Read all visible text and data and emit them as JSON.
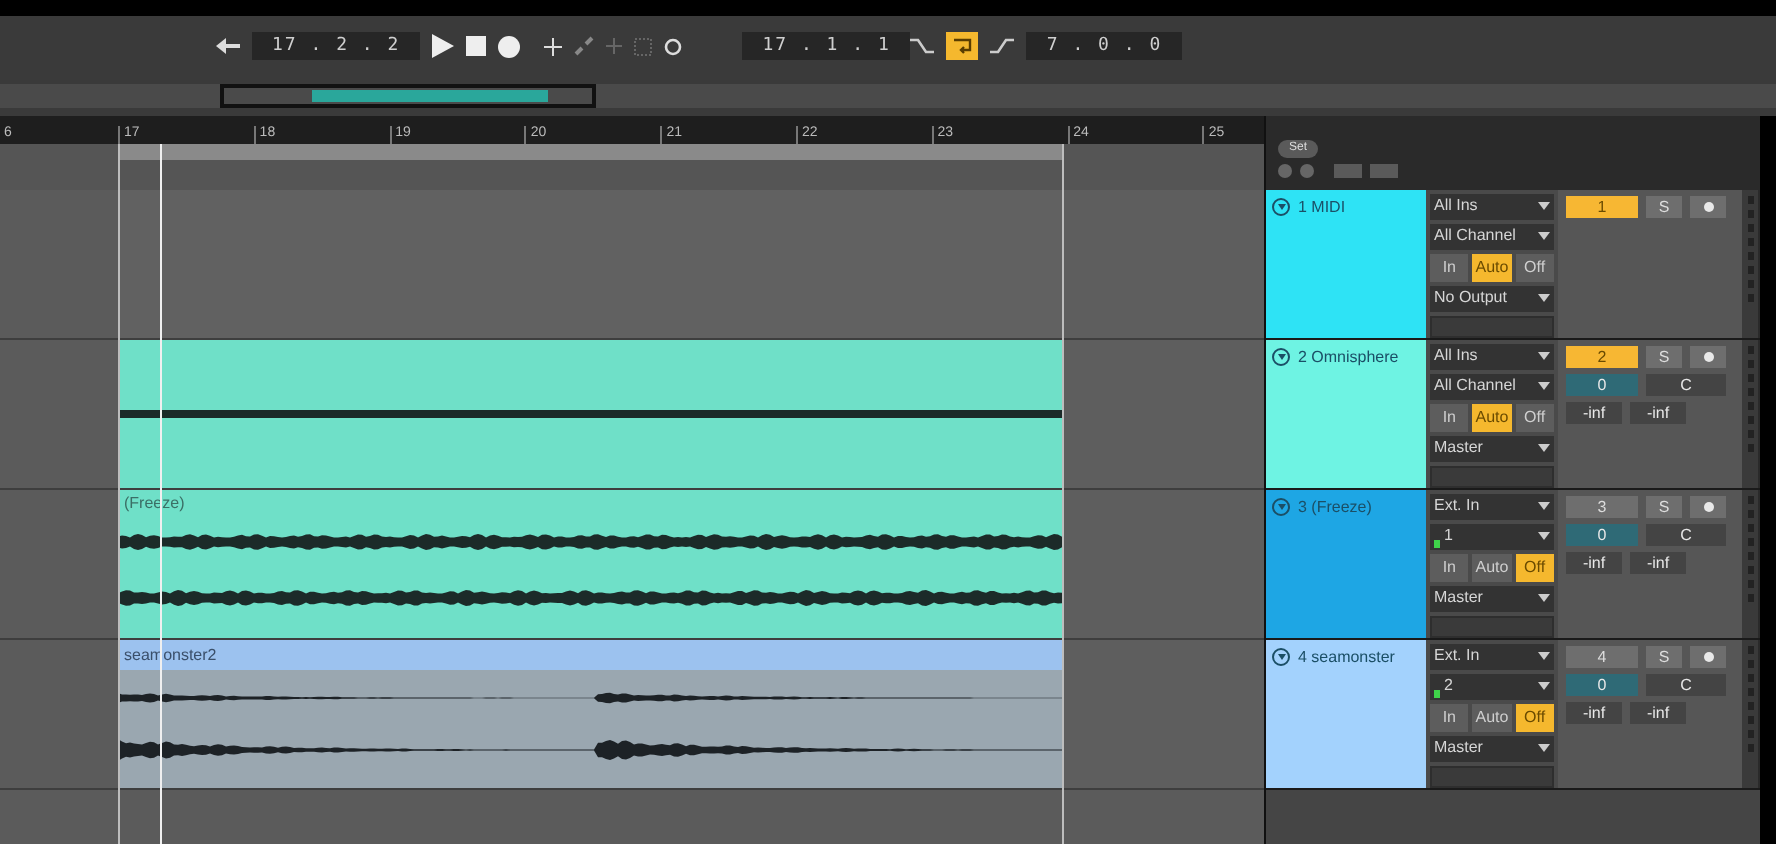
{
  "transport": {
    "position": "17 . 2 . 2",
    "loop_start": "17 . 1 . 1",
    "loop_on": true,
    "loop_length": "7 . 0 . 0"
  },
  "ruler": [
    "6",
    "17",
    "18",
    "19",
    "20",
    "21",
    "22",
    "23",
    "24",
    "25"
  ],
  "set_button": "Set",
  "tracks": [
    {
      "name": "1 MIDI",
      "color": "#2ee3f5",
      "input": "All Ins",
      "channel": {
        "text": "All Channel",
        "meter": false
      },
      "monitor": [
        {
          "label": "In",
          "selected": false
        },
        {
          "label": "Auto",
          "selected": true
        },
        {
          "label": "Off",
          "selected": false
        }
      ],
      "output": "No Output",
      "activator": {
        "label": "1",
        "on": true
      },
      "solo": "S"
    },
    {
      "name": "2 Omnisphere",
      "color": "#6ef3e3",
      "clip": {
        "kind": "midi",
        "color": "#6fe0c8"
      },
      "input": "All Ins",
      "channel": {
        "text": "All Channel",
        "meter": false
      },
      "monitor": [
        {
          "label": "In",
          "selected": false
        },
        {
          "label": "Auto",
          "selected": true
        },
        {
          "label": "Off",
          "selected": false
        }
      ],
      "output": "Master",
      "activator": {
        "label": "2",
        "on": true
      },
      "solo": "S",
      "volume": "0",
      "pan": "C",
      "meters": [
        "-inf",
        "-inf"
      ]
    },
    {
      "name": "3 (Freeze)",
      "color": "#1ea6e4",
      "clip": {
        "kind": "stereo",
        "title": "(Freeze)",
        "color": "#6fe0c8"
      },
      "input": "Ext. In",
      "channel": {
        "text": "1",
        "meter": true
      },
      "monitor": [
        {
          "label": "In",
          "selected": false
        },
        {
          "label": "Auto",
          "selected": false
        },
        {
          "label": "Off",
          "selected": true
        }
      ],
      "output": "Master",
      "activator": {
        "label": "3",
        "on": false
      },
      "solo": "S",
      "volume": "0",
      "pan": "C",
      "meters": [
        "-inf",
        "-inf"
      ]
    },
    {
      "name": "4 seamonster",
      "color": "#a3d2fd",
      "clip": {
        "kind": "sample",
        "title": "seamonster2",
        "color": "#9cc2ef"
      },
      "input": "Ext. In",
      "channel": {
        "text": "2",
        "meter": true
      },
      "monitor": [
        {
          "label": "In",
          "selected": false
        },
        {
          "label": "Auto",
          "selected": false
        },
        {
          "label": "Off",
          "selected": true
        }
      ],
      "output": "Master",
      "activator": {
        "label": "4",
        "on": false
      },
      "solo": "S",
      "volume": "0",
      "pan": "C",
      "meters": [
        "-inf",
        "-inf"
      ]
    }
  ]
}
